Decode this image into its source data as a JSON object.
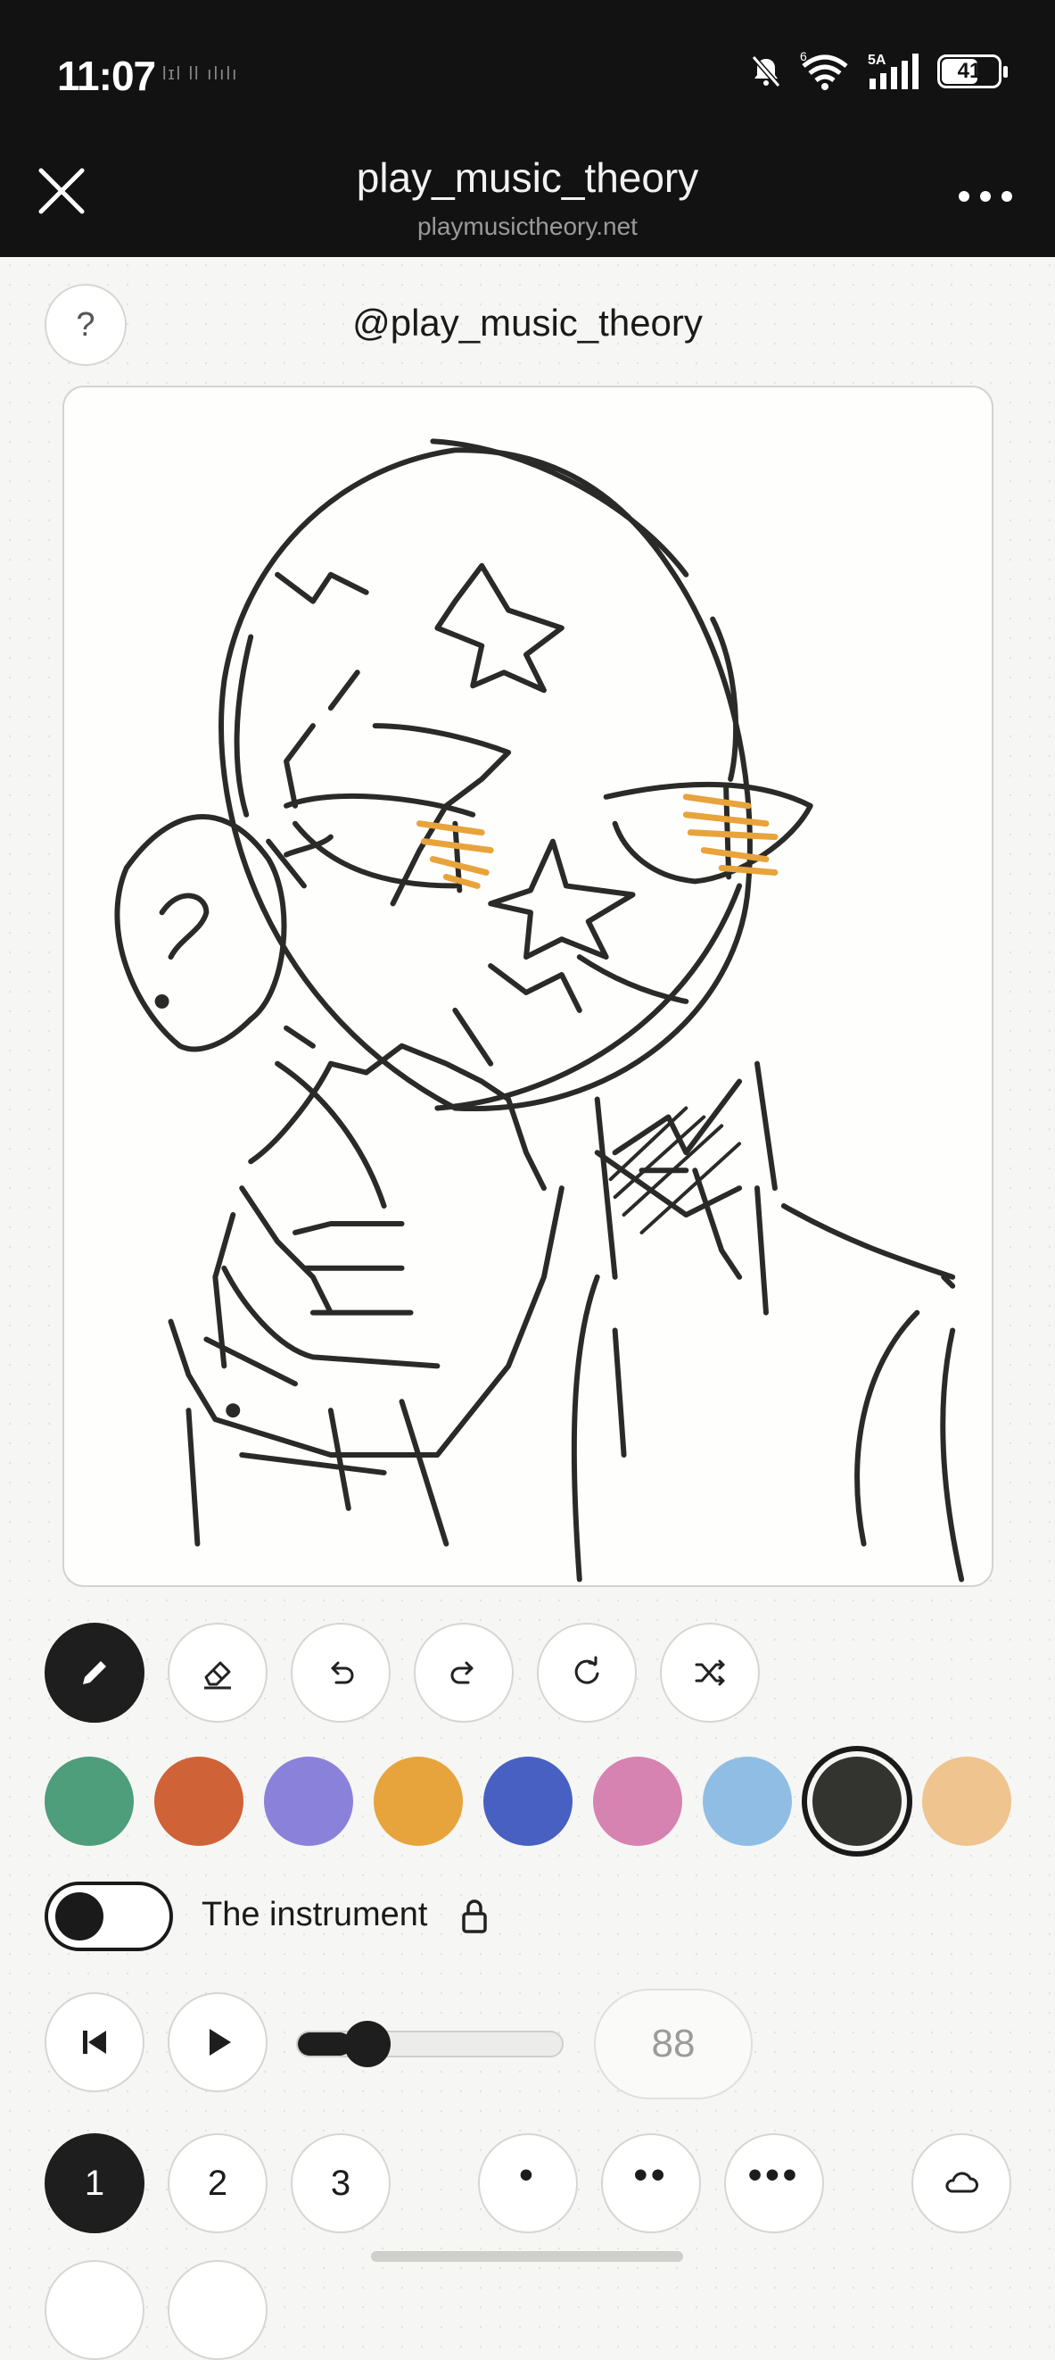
{
  "status_bar": {
    "time": "11:07",
    "carrier_note": "lɪl ll ılılı",
    "network": "5A",
    "wifi_badge": "6",
    "battery": "41"
  },
  "header": {
    "title": "play_music_theory",
    "url": "playmusictheory.net"
  },
  "help": {
    "label": "?"
  },
  "handle": "@play_music_theory",
  "tools": [
    "pencil-icon",
    "eraser-icon",
    "undo-icon",
    "redo-icon",
    "refresh-icon",
    "shuffle-icon"
  ],
  "palette": {
    "colors": [
      "#4e9d7b",
      "#cf6237",
      "#8a82da",
      "#e7a43c",
      "#4760c2",
      "#d683b1",
      "#90bde4",
      "#333330",
      "#efc48e"
    ],
    "selected_index": 7
  },
  "instrument": {
    "label": "The instrument",
    "toggle_on": false
  },
  "player": {
    "tempo": "88",
    "progress": 0.2
  },
  "voices": [
    "1",
    "2",
    "3"
  ],
  "active_voice": "1",
  "rhythms": [
    "•",
    "••",
    "•••"
  ],
  "cloud": "cloud-icon",
  "colors": {
    "accent": "#1e1e1e",
    "topbar": "#121212",
    "ink": "#2a2a28",
    "eye": "#e8a33a"
  }
}
